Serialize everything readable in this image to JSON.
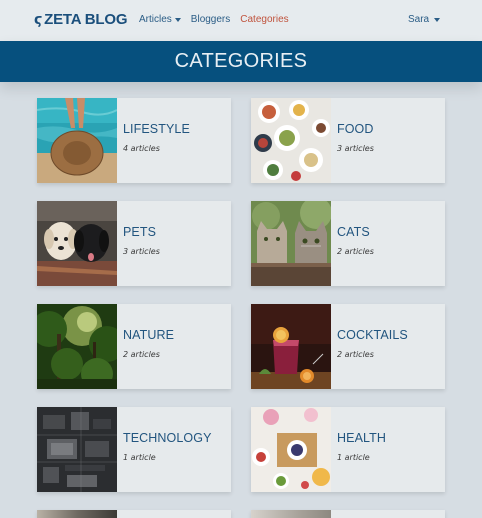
{
  "nav": {
    "brand": "ZETA BLOG",
    "links": [
      {
        "label": "Articles",
        "dropdown": true,
        "active": false
      },
      {
        "label": "Bloggers",
        "dropdown": false,
        "active": false
      },
      {
        "label": "Categories",
        "dropdown": false,
        "active": true
      }
    ],
    "user": "Sara"
  },
  "banner": {
    "title": "CATEGORIES"
  },
  "categories": [
    {
      "name": "LIFESTYLE",
      "count": "4 articles",
      "image": "lifestyle-photo"
    },
    {
      "name": "FOOD",
      "count": "3 articles",
      "image": "food-photo"
    },
    {
      "name": "PETS",
      "count": "3 articles",
      "image": "pets-photo"
    },
    {
      "name": "CATS",
      "count": "2 articles",
      "image": "cats-photo"
    },
    {
      "name": "NATURE",
      "count": "2 articles",
      "image": "nature-photo"
    },
    {
      "name": "COCKTAILS",
      "count": "2 articles",
      "image": "cocktails-photo"
    },
    {
      "name": "TECHNOLOGY",
      "count": "1 article",
      "image": "technology-photo"
    },
    {
      "name": "HEALTH",
      "count": "1 article",
      "image": "health-photo"
    }
  ],
  "colors": {
    "navbar_bg": "#e6ebee",
    "banner_bg": "#06507e",
    "page_bg": "#d6dde3",
    "card_bg": "#e6eaec",
    "accent_active": "#c0533d",
    "title_blue": "#22557f"
  }
}
